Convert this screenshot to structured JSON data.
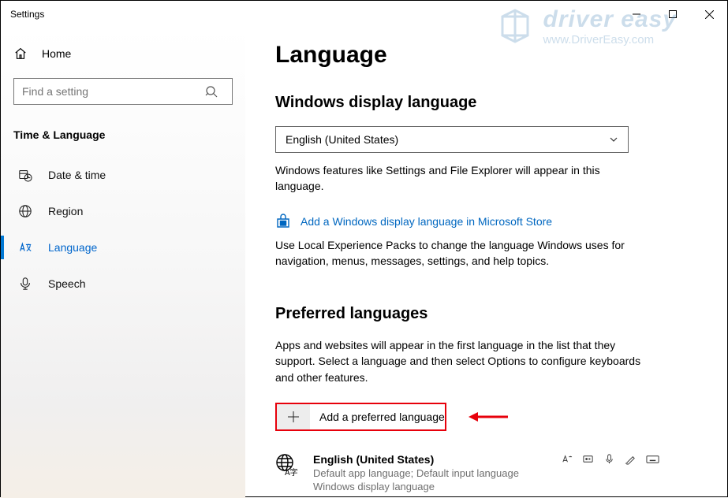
{
  "window": {
    "title": "Settings"
  },
  "watermark": {
    "title": "driver easy",
    "url": "www.DriverEasy.com"
  },
  "sidebar": {
    "home": "Home",
    "search_placeholder": "Find a setting",
    "section": "Time & Language",
    "items": [
      {
        "label": "Date & time"
      },
      {
        "label": "Region"
      },
      {
        "label": "Language"
      },
      {
        "label": "Speech"
      }
    ]
  },
  "main": {
    "title": "Language",
    "display": {
      "heading": "Windows display language",
      "selected": "English (United States)",
      "description": "Windows features like Settings and File Explorer will appear in this language.",
      "store_link": "Add a Windows display language in Microsoft Store",
      "packs_desc": "Use Local Experience Packs to change the language Windows uses for navigation, menus, messages, settings, and help topics."
    },
    "preferred": {
      "heading": "Preferred languages",
      "description": "Apps and websites will appear in the first language in the list that they support. Select a language and then select Options to configure keyboards and other features.",
      "add_label": "Add a preferred language",
      "items": [
        {
          "name": "English (United States)",
          "sub1": "Default app language; Default input language",
          "sub2": "Windows display language"
        }
      ]
    }
  }
}
